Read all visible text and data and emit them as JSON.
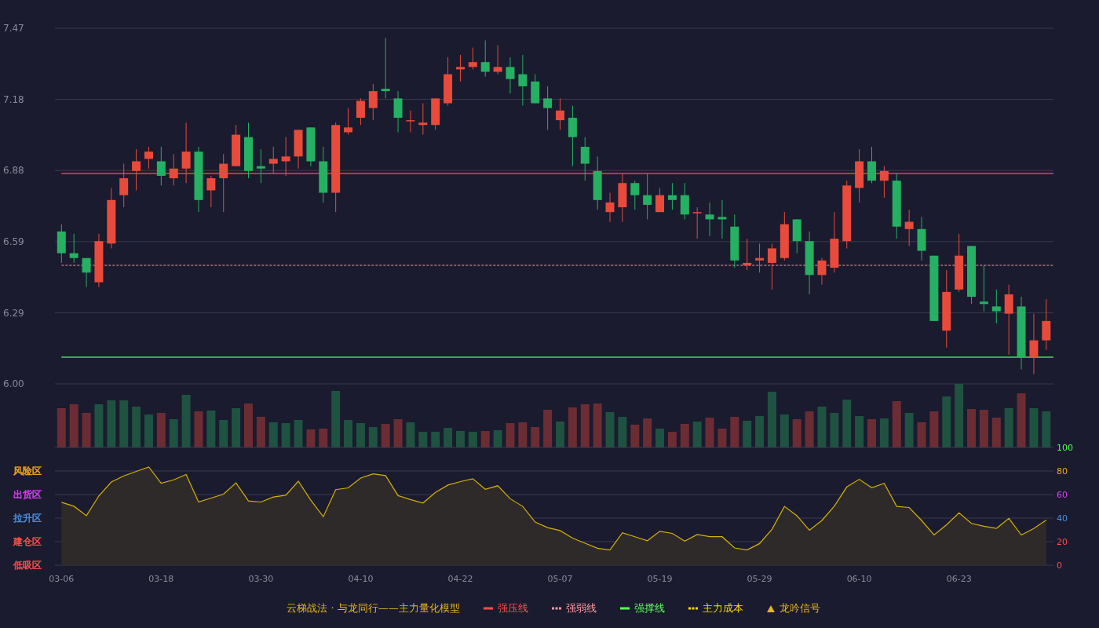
{
  "price_panel": {
    "chart_data": {
      "type": "candlestick",
      "grid": true,
      "ylim": [
        6.0,
        7.47
      ],
      "yticks": [
        {
          "value": 6.0,
          "label": "6.00"
        },
        {
          "value": 6.294,
          "label": "6.29"
        },
        {
          "value": 6.588,
          "label": "6.59"
        },
        {
          "value": 6.882,
          "label": "6.88"
        },
        {
          "value": 7.176,
          "label": "7.18"
        },
        {
          "value": 7.47,
          "label": "7.47"
        }
      ],
      "ohlc": [
        [
          6.63,
          6.66,
          6.5,
          6.54
        ],
        [
          6.54,
          6.62,
          6.5,
          6.52
        ],
        [
          6.52,
          6.52,
          6.4,
          6.46
        ],
        [
          6.42,
          6.62,
          6.4,
          6.59
        ],
        [
          6.58,
          6.81,
          6.56,
          6.76
        ],
        [
          6.78,
          6.91,
          6.73,
          6.85
        ],
        [
          6.88,
          6.97,
          6.8,
          6.92
        ],
        [
          6.93,
          6.98,
          6.89,
          6.96
        ],
        [
          6.92,
          6.98,
          6.82,
          6.86
        ],
        [
          6.85,
          6.95,
          6.82,
          6.89
        ],
        [
          6.89,
          7.08,
          6.83,
          6.96
        ],
        [
          6.96,
          6.98,
          6.71,
          6.76
        ],
        [
          6.8,
          6.86,
          6.73,
          6.85
        ],
        [
          6.85,
          6.95,
          6.71,
          6.91
        ],
        [
          6.9,
          7.07,
          6.9,
          7.03
        ],
        [
          7.02,
          7.08,
          6.85,
          6.88
        ],
        [
          6.9,
          6.97,
          6.83,
          6.89
        ],
        [
          6.91,
          6.98,
          6.87,
          6.93
        ],
        [
          6.92,
          7.02,
          6.86,
          6.94
        ],
        [
          6.94,
          7.05,
          6.89,
          7.05
        ],
        [
          7.06,
          7.06,
          6.9,
          6.92
        ],
        [
          6.92,
          6.98,
          6.75,
          6.79
        ],
        [
          6.79,
          7.08,
          6.71,
          7.07
        ],
        [
          7.04,
          7.14,
          7.03,
          7.06
        ],
        [
          7.1,
          7.18,
          7.07,
          7.17
        ],
        [
          7.14,
          7.24,
          7.09,
          7.21
        ],
        [
          7.22,
          7.43,
          7.18,
          7.21
        ],
        [
          7.18,
          7.21,
          7.04,
          7.1
        ],
        [
          7.09,
          7.13,
          7.04,
          7.09
        ],
        [
          7.07,
          7.16,
          7.03,
          7.08
        ],
        [
          7.07,
          7.18,
          7.05,
          7.18
        ],
        [
          7.16,
          7.35,
          7.15,
          7.28
        ],
        [
          7.3,
          7.36,
          7.25,
          7.31
        ],
        [
          7.31,
          7.39,
          7.3,
          7.33
        ],
        [
          7.33,
          7.42,
          7.27,
          7.29
        ],
        [
          7.29,
          7.4,
          7.28,
          7.31
        ],
        [
          7.31,
          7.35,
          7.2,
          7.26
        ],
        [
          7.28,
          7.36,
          7.15,
          7.23
        ],
        [
          7.25,
          7.28,
          7.16,
          7.16
        ],
        [
          7.18,
          7.23,
          7.05,
          7.14
        ],
        [
          7.09,
          7.18,
          7.05,
          7.13
        ],
        [
          7.1,
          7.15,
          6.9,
          7.02
        ],
        [
          6.98,
          7.02,
          6.84,
          6.91
        ],
        [
          6.88,
          6.94,
          6.72,
          6.76
        ],
        [
          6.71,
          6.79,
          6.67,
          6.75
        ],
        [
          6.73,
          6.87,
          6.67,
          6.83
        ],
        [
          6.83,
          6.84,
          6.72,
          6.78
        ],
        [
          6.78,
          6.87,
          6.68,
          6.74
        ],
        [
          6.71,
          6.81,
          6.71,
          6.78
        ],
        [
          6.78,
          6.83,
          6.72,
          6.76
        ],
        [
          6.78,
          6.83,
          6.68,
          6.7
        ],
        [
          6.71,
          6.73,
          6.6,
          6.71
        ],
        [
          6.7,
          6.75,
          6.61,
          6.68
        ],
        [
          6.69,
          6.76,
          6.6,
          6.68
        ],
        [
          6.65,
          6.7,
          6.48,
          6.51
        ],
        [
          6.49,
          6.6,
          6.47,
          6.5
        ],
        [
          6.51,
          6.58,
          6.46,
          6.52
        ],
        [
          6.5,
          6.58,
          6.39,
          6.56
        ],
        [
          6.52,
          6.71,
          6.51,
          6.66
        ],
        [
          6.68,
          6.68,
          6.54,
          6.59
        ],
        [
          6.59,
          6.63,
          6.37,
          6.45
        ],
        [
          6.45,
          6.52,
          6.41,
          6.51
        ],
        [
          6.48,
          6.71,
          6.46,
          6.6
        ],
        [
          6.59,
          6.84,
          6.56,
          6.82
        ],
        [
          6.81,
          6.97,
          6.75,
          6.92
        ],
        [
          6.92,
          6.98,
          6.83,
          6.84
        ],
        [
          6.84,
          6.9,
          6.77,
          6.88
        ],
        [
          6.84,
          6.87,
          6.6,
          6.65
        ],
        [
          6.64,
          6.72,
          6.57,
          6.67
        ],
        [
          6.64,
          6.69,
          6.51,
          6.55
        ],
        [
          6.53,
          6.53,
          6.26,
          6.26
        ],
        [
          6.22,
          6.47,
          6.15,
          6.38
        ],
        [
          6.39,
          6.62,
          6.38,
          6.53
        ],
        [
          6.57,
          6.57,
          6.33,
          6.36
        ],
        [
          6.34,
          6.49,
          6.3,
          6.33
        ],
        [
          6.32,
          6.39,
          6.25,
          6.3
        ],
        [
          6.29,
          6.41,
          6.12,
          6.37
        ],
        [
          6.32,
          6.36,
          6.06,
          6.11
        ],
        [
          6.11,
          6.29,
          6.04,
          6.18
        ],
        [
          6.18,
          6.35,
          6.14,
          6.26
        ]
      ],
      "ref_lines": [
        {
          "axis": "y",
          "value": 6.87,
          "color": "#ff3b3b"
        },
        {
          "axis": "y",
          "value": 6.49,
          "color": "#f0a0a8"
        },
        {
          "axis": "y",
          "value": 6.11,
          "color": "#4cd964"
        }
      ]
    }
  },
  "oscillator_panel": {
    "zones": [
      {
        "label": "风险区",
        "color": "#f5a623"
      },
      {
        "label": "出货区",
        "color": "#e040fb"
      },
      {
        "label": "拉升区",
        "color": "#4a90e2"
      },
      {
        "label": "建仓区",
        "color": "#ff4d4d"
      },
      {
        "label": "低吸区",
        "color": "#ff4d4d"
      }
    ],
    "chart_data": {
      "type": "area",
      "grid": true,
      "ylim": [
        0,
        100
      ],
      "yticks": [
        {
          "value": 100,
          "label": "100"
        },
        {
          "value": 80,
          "label": "80"
        },
        {
          "value": 60,
          "label": "60"
        },
        {
          "value": 40,
          "label": "40"
        },
        {
          "value": 20,
          "label": "20"
        },
        {
          "value": 0,
          "label": "0"
        }
      ],
      "categories": [
        "03-06",
        null,
        null,
        null,
        null,
        null,
        null,
        null,
        "03-18",
        null,
        null,
        null,
        null,
        null,
        null,
        null,
        "03-30",
        null,
        null,
        null,
        null,
        null,
        null,
        null,
        "04-10",
        null,
        null,
        null,
        null,
        null,
        null,
        null,
        "04-22",
        null,
        null,
        null,
        null,
        null,
        null,
        null,
        "05-07",
        null,
        null,
        null,
        null,
        null,
        null,
        null,
        "05-19",
        null,
        null,
        null,
        null,
        null,
        null,
        null,
        "05-29",
        null,
        null,
        null,
        null,
        null,
        null,
        null,
        "06-10",
        null,
        null,
        null,
        null,
        null,
        null,
        null,
        "06-23",
        null,
        null,
        null,
        null,
        null,
        null,
        null
      ],
      "series": [
        {
          "color": "#d4b106",
          "values": [
            53.4,
            50.1,
            42.1,
            58.8,
            70.7,
            75.8,
            79.7,
            83.3,
            69.6,
            72.5,
            77.0,
            53.7,
            57.0,
            60.3,
            69.9,
            54.6,
            53.7,
            57.9,
            59.4,
            71.3,
            55.2,
            41.2,
            64.2,
            65.7,
            74.0,
            77.6,
            76.1,
            59.1,
            55.8,
            52.8,
            61.8,
            68.1,
            71.0,
            73.4,
            64.5,
            67.5,
            56.4,
            49.9,
            36.7,
            31.9,
            29.4,
            23.0,
            18.7,
            14.4,
            12.9,
            27.6,
            24.2,
            20.8,
            28.8,
            27.0,
            20.5,
            26.0,
            24.2,
            24.2,
            14.7,
            12.9,
            18.4,
            30.6,
            49.9,
            42.0,
            29.7,
            38.0,
            50.2,
            66.5,
            72.9,
            65.8,
            69.5,
            49.9,
            49.0,
            38.0,
            25.7,
            34.3,
            44.4,
            35.5,
            33.1,
            31.2,
            39.8,
            25.7,
            31.2,
            38.3
          ]
        }
      ]
    }
  },
  "legend": {
    "title": "云梯战法 · 与龙同行——主力量化模型",
    "items": [
      {
        "kind": "line",
        "label": "强压线",
        "color": "#ff4d4d"
      },
      {
        "kind": "dashed",
        "label": "强弱线",
        "color": "#ff9aa2"
      },
      {
        "kind": "line",
        "label": "强撑线",
        "color": "#5cff5c"
      },
      {
        "kind": "dashed",
        "label": "主力成本",
        "color": "#ffd700"
      },
      {
        "kind": "triangle",
        "label": "龙吟信号",
        "color": "#e6b422"
      }
    ]
  }
}
